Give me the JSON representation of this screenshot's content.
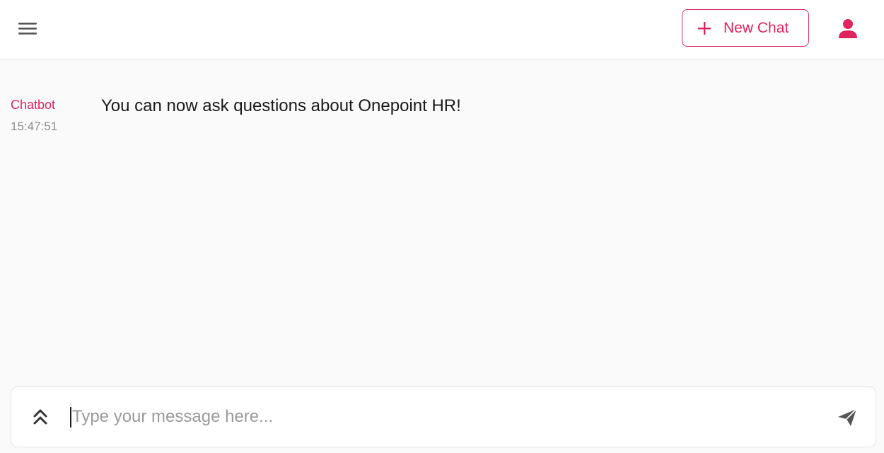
{
  "header": {
    "menu_icon": "hamburger-menu-icon",
    "new_chat_label": "New Chat",
    "new_chat_icon": "plus-icon",
    "user_icon": "user-icon"
  },
  "messages": [
    {
      "author": "Chatbot",
      "time": "15:47:51",
      "text": "You can now ask questions about Onepoint HR!"
    }
  ],
  "composer": {
    "placeholder": "Type your message here...",
    "value": "",
    "expand_icon": "double-chevron-up-icon",
    "send_icon": "send-icon"
  },
  "colors": {
    "accent": "#e0245e",
    "background": "#fafafa",
    "surface": "#ffffff",
    "icon": "#555555"
  }
}
